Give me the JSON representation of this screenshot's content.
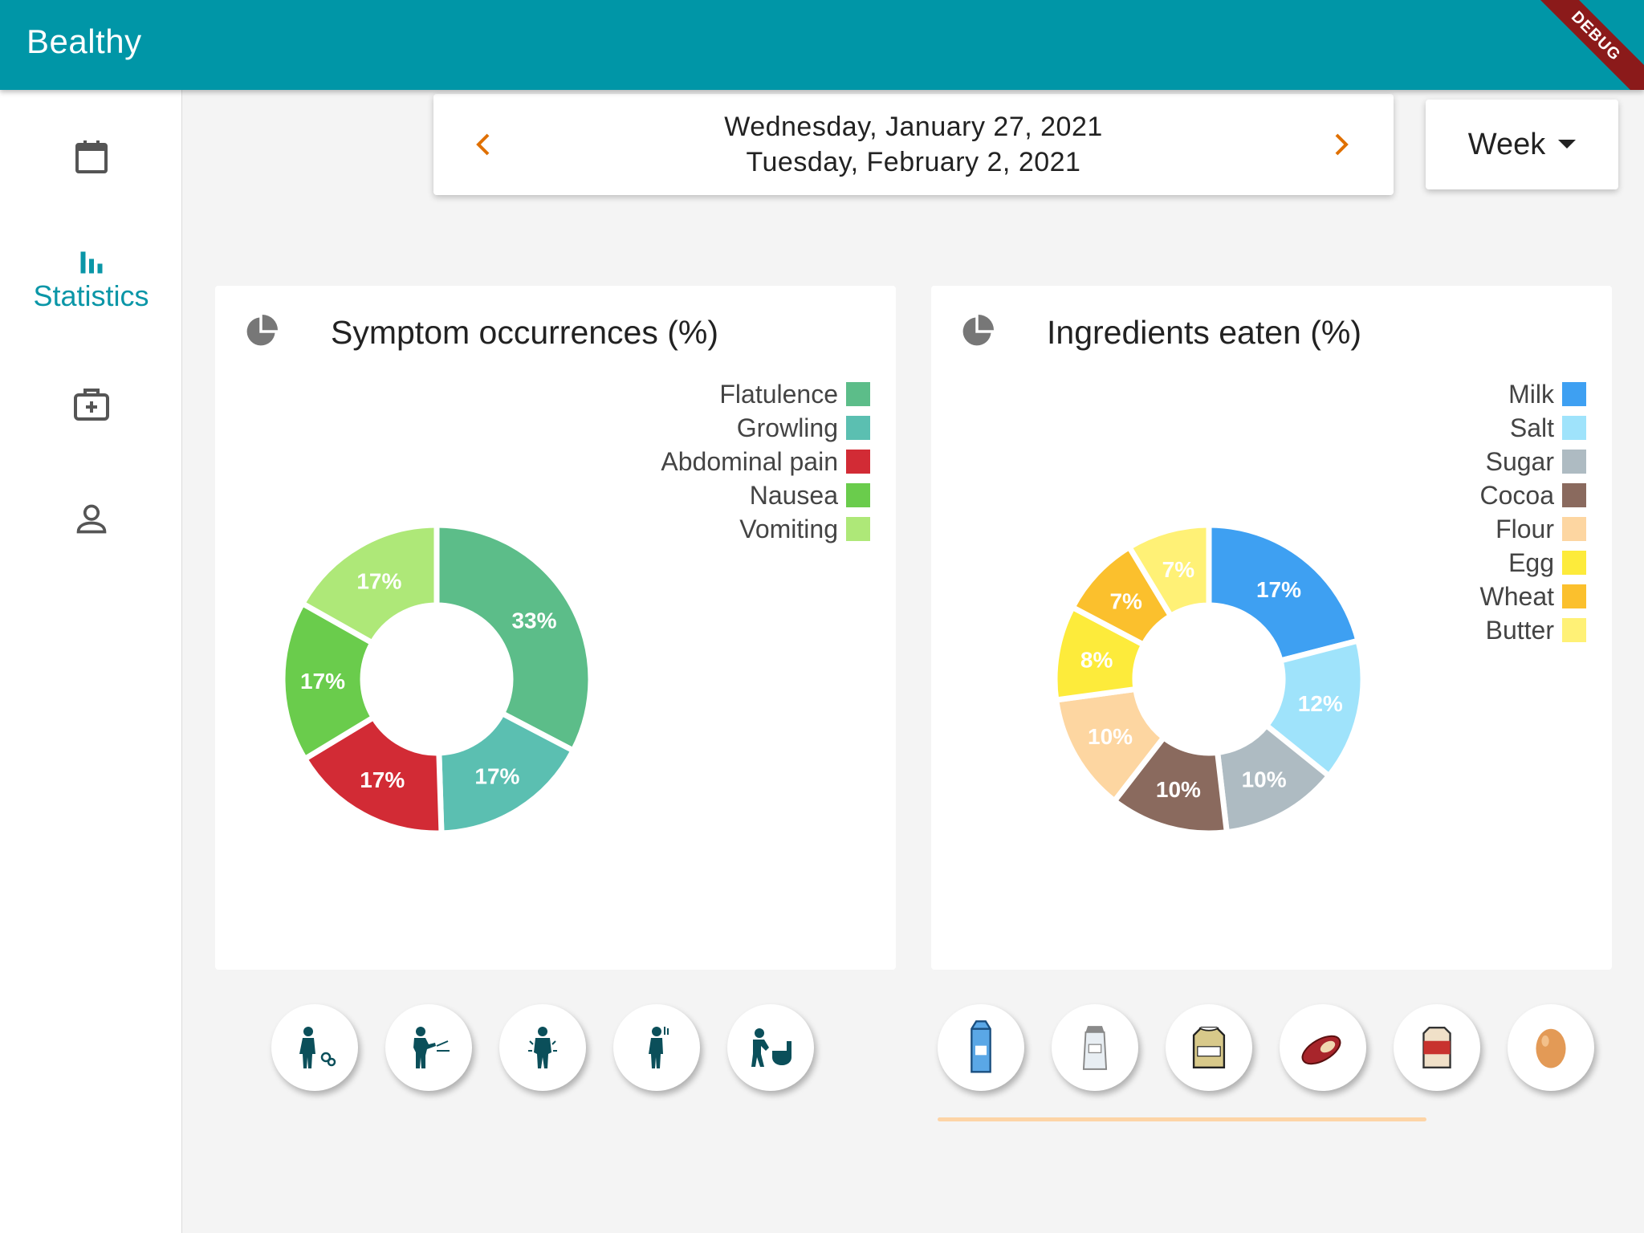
{
  "app": {
    "title": "Bealthy",
    "debug_label": "DEBUG"
  },
  "sidebar": {
    "items": [
      {
        "icon": "calendar-icon",
        "label": ""
      },
      {
        "icon": "bar-chart-icon",
        "label": "Statistics"
      },
      {
        "icon": "medical-case-icon",
        "label": ""
      },
      {
        "icon": "person-icon",
        "label": ""
      }
    ]
  },
  "date_range": {
    "start": "Wednesday, January 27, 2021",
    "end": "Tuesday, February 2, 2021"
  },
  "period_selector": {
    "value": "Week"
  },
  "colors": {
    "accent": "#0096a7",
    "arrow": "#e07000"
  },
  "symptoms": {
    "title": "Symptom occurrences (%)",
    "icons": [
      "flatulence-icon",
      "growling-icon",
      "abdominal-pain-icon",
      "nausea-icon",
      "vomiting-icon"
    ]
  },
  "ingredients": {
    "title": "Ingredients eaten (%)",
    "icons": [
      "milk-icon",
      "salt-icon",
      "sugar-icon",
      "cocoa-icon",
      "flour-icon",
      "egg-icon"
    ]
  },
  "chart_data": [
    {
      "type": "pie",
      "title": "Symptom occurrences (%)",
      "categories": [
        "Flatulence",
        "Growling",
        "Abdominal pain",
        "Nausea",
        "Vomiting"
      ],
      "values": [
        33,
        17,
        17,
        17,
        17
      ],
      "labels": [
        "33%",
        "17%",
        "17%",
        "17%",
        "17%"
      ],
      "colors": [
        "#5cbd89",
        "#5bbfb1",
        "#d22b35",
        "#6acc4c",
        "#aee878"
      ],
      "legend": "top-right"
    },
    {
      "type": "pie",
      "title": "Ingredients eaten (%)",
      "categories": [
        "Milk",
        "Salt",
        "Sugar",
        "Cocoa",
        "Flour",
        "Egg",
        "Wheat",
        "Butter"
      ],
      "values": [
        17,
        12,
        10,
        10,
        10,
        8,
        7,
        7
      ],
      "labels": [
        "17%",
        "12%",
        "10%",
        "10%",
        "10%",
        "8%",
        "7%",
        "7%"
      ],
      "colors": [
        "#3ea0f2",
        "#9fe3fb",
        "#aebbc2",
        "#8a6a5e",
        "#fdd6a1",
        "#fdeb3b",
        "#fbc02d",
        "#fff176"
      ],
      "legend": "top-right"
    }
  ]
}
